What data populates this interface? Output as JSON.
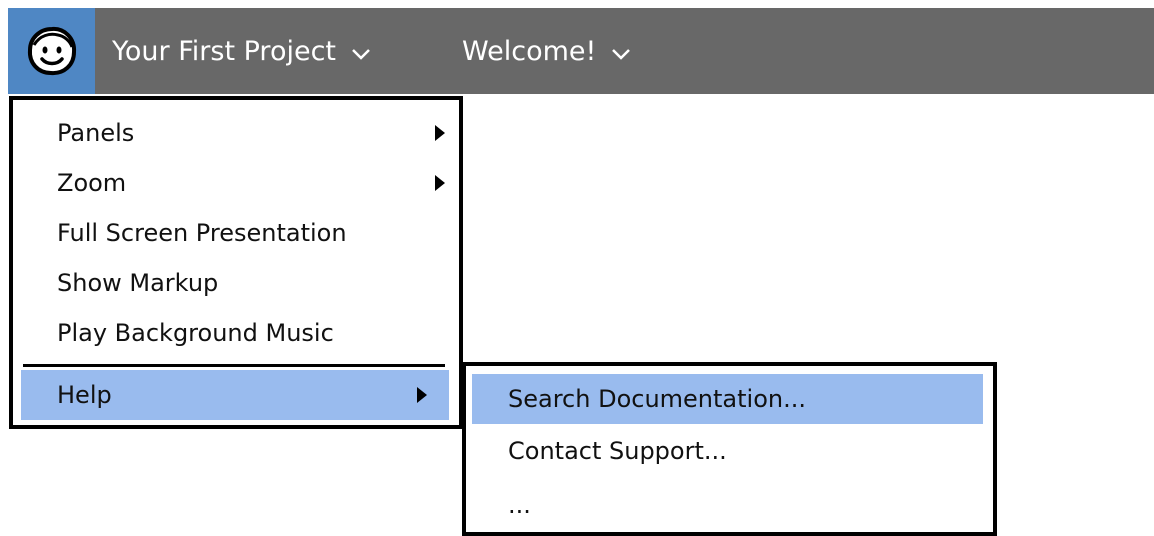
{
  "topbar": {
    "logo_icon": "smiley-face-icon",
    "menus": [
      {
        "label": "Your First Project",
        "chevron": "chevron-down-icon"
      },
      {
        "label": "Welcome!",
        "chevron": "chevron-down-icon"
      }
    ],
    "background_color": "#686868",
    "logo_background_color": "#4f87c4"
  },
  "view_menu": {
    "items": [
      {
        "label": "Panels",
        "has_submenu": true
      },
      {
        "label": "Zoom",
        "has_submenu": true
      },
      {
        "label": "Full Screen Presentation",
        "has_submenu": false
      },
      {
        "label": "Show Markup",
        "has_submenu": false
      },
      {
        "label": "Play Background Music",
        "has_submenu": false
      },
      {
        "label": "Help",
        "has_submenu": true,
        "selected": true
      }
    ]
  },
  "help_submenu": {
    "items": [
      {
        "label": "Search Documentation...",
        "selected": true
      },
      {
        "label": "Contact Support..."
      },
      {
        "label": "..."
      }
    ]
  },
  "selection_color": "#99bbee"
}
